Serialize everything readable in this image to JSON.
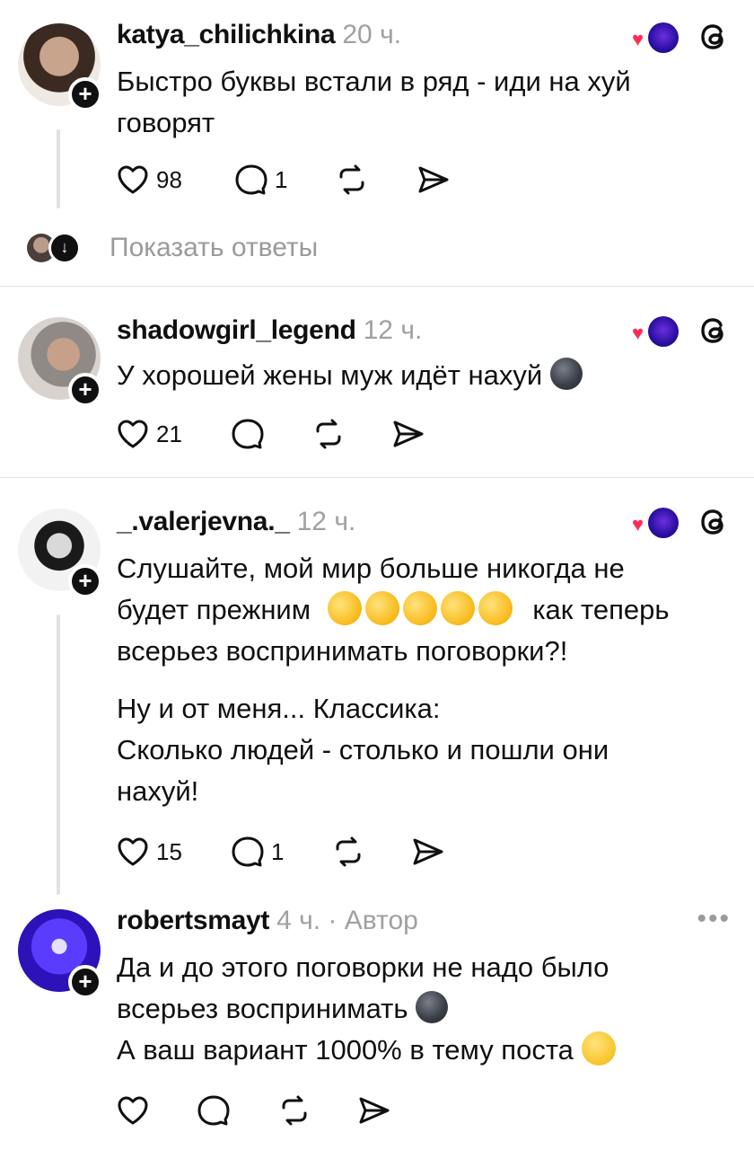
{
  "comments": [
    {
      "username": "katya_chilichkina",
      "time": "20 ч.",
      "lines": [
        "Быстро буквы встали в ряд - иди  на хуй",
        "говорят"
      ],
      "likes": "98",
      "replies": "1"
    },
    {
      "username": "shadowgirl_legend",
      "time": "12 ч.",
      "lines": [
        "У хорошей жены муж идёт нахуй"
      ],
      "likes": "21",
      "replies": ""
    },
    {
      "username": "_.valerjevna._",
      "time": "12 ч.",
      "lines": [
        "Слушайте, мой мир больше никогда не",
        "будет прежним",
        "как теперь",
        "всерьез воспринимать поговорки?!",
        "Ну и от меня... Классика:",
        "Сколько людей - столько и пошли они",
        "нахуй!"
      ],
      "likes": "15",
      "replies": "1"
    },
    {
      "username": "robertsmayt",
      "time": "4 ч.",
      "author_tag": "· Автор",
      "lines": [
        "Да и до этого поговорки не надо было",
        "всерьез воспринимать",
        "А ваш вариант 1000% в тему поста"
      ],
      "likes": "",
      "replies": ""
    }
  ],
  "show_replies_label": "Показать ответы",
  "icons": {
    "like": "heart-icon",
    "reply": "comment-icon",
    "repost": "repost-icon",
    "share": "send-icon",
    "threads": "threads-logo-icon",
    "plus": "follow-plus-icon",
    "more": "more-dots-icon"
  },
  "colors": {
    "text": "#101010",
    "muted": "#a0a0a0",
    "heart": "#ff2c55",
    "divider": "#e3e3e3"
  }
}
